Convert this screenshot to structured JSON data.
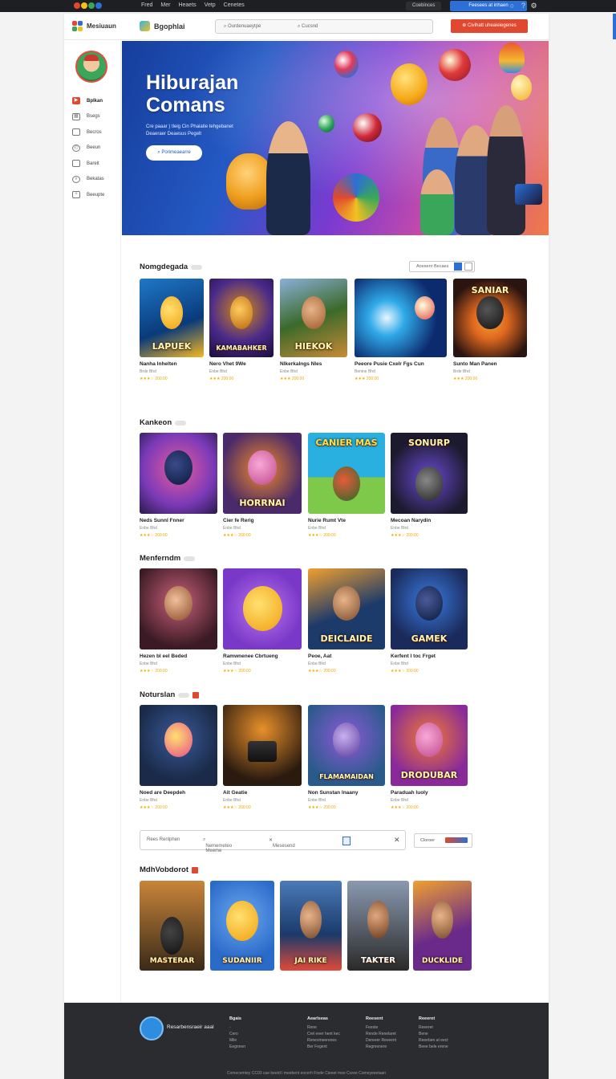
{
  "topbar": {
    "menu": [
      "Fred",
      "Mer",
      "Heaets",
      "Vetp",
      "Cenetes"
    ],
    "account": "Coebinces",
    "cta": "Feesees at inhaen"
  },
  "header": {
    "brand1": "Mesiuaun",
    "brand2": "Bgophlai",
    "search1": "Ourdenuaeytpe",
    "search2": "Cucsnd",
    "red_button": "Civihatt uheaieiegenes"
  },
  "sidebar": {
    "items": [
      {
        "icon": "play-icon",
        "label": "Bplkan",
        "active": true
      },
      {
        "icon": "grid-icon",
        "label": "Bsegs",
        "active": false
      },
      {
        "icon": "square-icon",
        "label": "Becros",
        "active": false
      },
      {
        "icon": "clock-icon",
        "label": "Beeun",
        "active": false
      },
      {
        "icon": "box-icon",
        "label": "Bareit",
        "active": false
      },
      {
        "icon": "search-icon",
        "label": "Bekatas",
        "active": false
      },
      {
        "icon": "plus-box-icon",
        "label": "Beeupte",
        "active": false
      }
    ]
  },
  "hero": {
    "title": "Hiburajan Comans",
    "subtitle": "Cre paaar ) tleig Cin Phaiatie tehgebanet Deaeraer Deaesus Pegelt",
    "button": "Porimeaearre"
  },
  "sort": {
    "label": "Aoesenr Becaes"
  },
  "sections": [
    {
      "title": "Nomgdegada",
      "cards": [
        {
          "name": "Nanha lnhelten",
          "meta": "Brde Bhd",
          "rating": "★★★☆ 200:00",
          "tag": "LAPUEK",
          "colors": [
            "#1e78c8",
            "#f5b820"
          ]
        },
        {
          "name": "Nero Vhet 9We",
          "meta": "Enbe Bhd",
          "rating": "★★★ 200:00",
          "tag": "KAMABAHKER",
          "colors": [
            "#2a1d5a",
            "#d48a18"
          ]
        },
        {
          "name": "Nlkerkalngs Nles",
          "meta": "Enbe Bhd",
          "rating": "★★★ 200:00",
          "tag": "HIEKOK",
          "colors": [
            "#3b6a2a",
            "#c98a36"
          ]
        },
        {
          "name": "Peeore Pusie Cxelr Fgs Cun",
          "meta": "Benine Bhd",
          "rating": "★★★ 200:00",
          "tag": "",
          "colors": [
            "#0c2b6e",
            "#2fa9e8"
          ]
        },
        {
          "name": "Sunto Man Panen",
          "meta": "Brde Bhd",
          "rating": "★★★ 200:00",
          "tag": "SANIAR",
          "colors": [
            "#2a1410",
            "#e0681f"
          ]
        }
      ]
    },
    {
      "title": "Kankeon",
      "cards": [
        {
          "name": "Neds Sunnl Fnner",
          "meta": "Enbe Bhd",
          "rating": "★★★☆ 200:00",
          "tag": "",
          "colors": [
            "#7a3ab8",
            "#e85a9c"
          ]
        },
        {
          "name": "Cier fe Rerig",
          "meta": "Enbe Bhd",
          "rating": "★★★☆ 200:00",
          "tag": "HORRNAI",
          "colors": [
            "#4a2a68",
            "#f08a2a"
          ]
        },
        {
          "name": "Nurie Rumt Vte",
          "meta": "Enbe Bhd",
          "rating": "★★★☆ 200:00",
          "tag": "CANIER MAS",
          "colors": [
            "#2ab0e0",
            "#7fc94a"
          ]
        },
        {
          "name": "Mecoan Narydin",
          "meta": "Enbe Bhd",
          "rating": "★★★☆ 200:00",
          "tag": "SONURP",
          "colors": [
            "#1c1a2e",
            "#6a4ad0"
          ]
        }
      ]
    },
    {
      "title": "Menferndm",
      "cards": [
        {
          "name": "Hezen bl eel Beded",
          "meta": "Enbe Bhd",
          "rating": "★★★☆ 200:00",
          "tag": "",
          "colors": [
            "#3a1a24",
            "#c8607a"
          ]
        },
        {
          "name": "Ramwnenee Cbrtueng",
          "meta": "Enbe Bhd",
          "rating": "★★★☆ 200:00",
          "tag": "",
          "colors": [
            "#7a38c8",
            "#f5b830"
          ]
        },
        {
          "name": "Peoe, Aat",
          "meta": "Enbe Bhd",
          "rating": "★★★☆ 200:00",
          "tag": "DEICLAIDE",
          "colors": [
            "#1c3a6a",
            "#f0a030"
          ]
        },
        {
          "name": "Kerfent l toc Frget",
          "meta": "Enbe Bhd",
          "rating": "★★★☆ 200:00",
          "tag": "GAMEK",
          "colors": [
            "#1a2a5a",
            "#3a7ae0"
          ]
        }
      ]
    },
    {
      "title": "Noturslan",
      "cards": [
        {
          "name": "Noed are Deepdeh",
          "meta": "Enbe Bhd",
          "rating": "★★★☆ 200:00",
          "tag": "",
          "colors": [
            "#1a2a48",
            "#e84a8a"
          ]
        },
        {
          "name": "Ait Geatie",
          "meta": "Enbe Bhd",
          "rating": "★★★☆ 200:00",
          "tag": "",
          "colors": [
            "#2a1a10",
            "#e8902a"
          ]
        },
        {
          "name": "Non Sunstan lnaany",
          "meta": "Enbe Bhd",
          "rating": "★★★☆ 200:00",
          "tag": "FLAMAMAIDAN",
          "colors": [
            "#2a5a8a",
            "#8a5ad8"
          ]
        },
        {
          "name": "Paraduah luoly",
          "meta": "Enbe Bhd",
          "rating": "★★★☆ 200:00",
          "tag": "DRODUBAR",
          "colors": [
            "#8a2a9a",
            "#f07a30"
          ]
        }
      ]
    },
    {
      "title": "MdhVobdorot",
      "cards": [
        {
          "name": "",
          "meta": "",
          "rating": "",
          "tag": "MASTERAR",
          "colors": [
            "#3a2a18",
            "#c8843a"
          ]
        },
        {
          "name": "",
          "meta": "",
          "rating": "",
          "tag": "SUDANIIR",
          "colors": [
            "#2a6ac8",
            "#f5b830"
          ]
        },
        {
          "name": "",
          "meta": "",
          "rating": "",
          "tag": "JAI RIKE",
          "colors": [
            "#1a3a6a",
            "#e04a3a"
          ]
        },
        {
          "name": "",
          "meta": "",
          "rating": "",
          "tag": "TAKTER",
          "colors": [
            "#2a2a2a",
            "#8a9ab0"
          ]
        },
        {
          "name": "",
          "meta": "",
          "rating": "",
          "tag": "DUCKLIDE",
          "colors": [
            "#6a2a8a",
            "#f0a030"
          ]
        }
      ]
    }
  ],
  "filter": {
    "f1": "Rees Renlphen",
    "f2": "Nememeteo Meeme",
    "f3": "Mesesend",
    "button": "Cloroer"
  },
  "footer": {
    "brand": "Resarbensraeir aaal",
    "columns": [
      {
        "title": "Bgais",
        "items": [
          "-",
          "Cero",
          "Mile",
          "Eegnnen"
        ]
      },
      {
        "title": "Aearlseas",
        "items": [
          "Rene",
          "Crel eeer hent kec",
          "Renesmeerenes",
          "Ber Fegent"
        ]
      },
      {
        "title": "Reesent",
        "items": [
          "Feeste",
          "Rende Renelaret",
          "Dereeer Reveent",
          "Regmenere"
        ]
      },
      {
        "title": "Reeeret",
        "items": [
          "Reeeret",
          "Bene",
          "Reeeben at eect",
          "Beee bele erene"
        ]
      }
    ],
    "copyright": "Comecemtey CC03 cae beetd l meebent eocerh Fnele Cieeet mee Coree Comeyeeetaan"
  }
}
